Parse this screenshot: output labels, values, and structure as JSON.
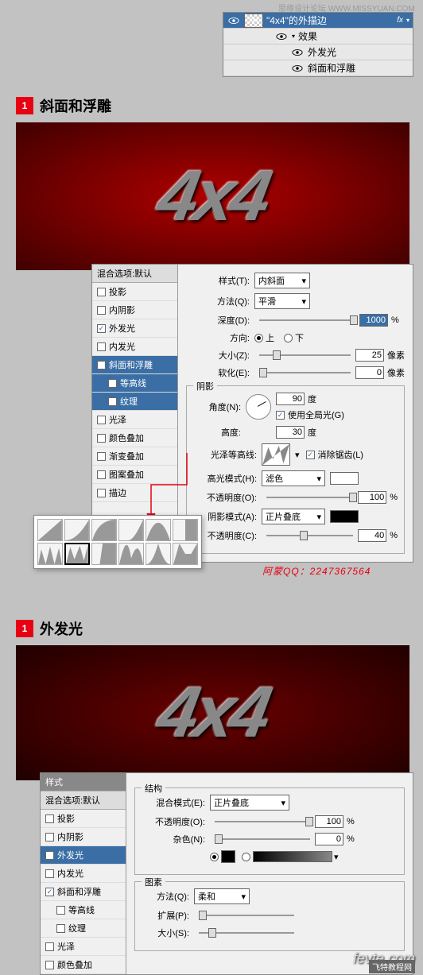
{
  "watermark_top": "思缘设计论坛 WWW.MISSYUAN.COM",
  "layers_panel": {
    "main_layer": "\"4x4\"的外描边",
    "fx": "fx",
    "effects": "效果",
    "outer_glow": "外发光",
    "bevel": "斜面和浮雕"
  },
  "section1": {
    "badge": "1",
    "title": "斜面和浮雕"
  },
  "preview_text": "4x4",
  "style_sidebar": {
    "blend_header": "混合选项:默认",
    "drop_shadow": "投影",
    "inner_shadow": "内阴影",
    "outer_glow": "外发光",
    "inner_glow": "内发光",
    "bevel": "斜面和浮雕",
    "contour": "等高线",
    "texture": "纹理",
    "satin": "光泽",
    "color_overlay": "颜色叠加",
    "gradient_overlay": "渐变叠加",
    "pattern_overlay": "图案叠加",
    "stroke": "描边"
  },
  "bevel_panel": {
    "style_label": "样式(T):",
    "style_value": "内斜面",
    "technique_label": "方法(Q):",
    "technique_value": "平滑",
    "depth_label": "深度(D):",
    "depth_value": "1000",
    "depth_unit": "%",
    "direction_label": "方向:",
    "up": "上",
    "down": "下",
    "size_label": "大小(Z):",
    "size_value": "25",
    "size_unit": "像素",
    "soften_label": "软化(E):",
    "soften_value": "0",
    "soften_unit": "像素",
    "shadow_group": "阴影",
    "angle_label": "角度(N):",
    "angle_value": "90",
    "degree": "度",
    "global_light": "使用全局光(G)",
    "altitude_label": "高度:",
    "altitude_value": "30",
    "gloss_contour_label": "光泽等高线:",
    "antialias": "消除锯齿(L)",
    "highlight_mode_label": "高光模式(H):",
    "highlight_mode_value": "滤色",
    "opacity_label": "不透明度(O):",
    "highlight_opacity": "100",
    "shadow_mode_label": "阴影模式(A):",
    "shadow_mode_value": "正片叠底",
    "opacity_label2": "不透明度(C):",
    "shadow_opacity": "40",
    "percent": "%"
  },
  "credit": "阿蒙QQ：2247367564",
  "section2": {
    "badge": "1",
    "title": "外发光"
  },
  "glow_dialog": {
    "style_header": "样式",
    "structure_group": "结构",
    "blend_mode_label": "混合模式(E):",
    "blend_mode_value": "正片叠底",
    "opacity_label": "不透明度(O):",
    "opacity_value": "100",
    "percent": "%",
    "noise_label": "杂色(N):",
    "noise_value": "0",
    "element_group": "图素",
    "technique_label": "方法(Q):",
    "technique_value": "柔和",
    "spread_label": "扩展(P):",
    "size_label": "大小(S):"
  },
  "fevte": "fevte.com",
  "fevte_sub": "飞特教程网"
}
